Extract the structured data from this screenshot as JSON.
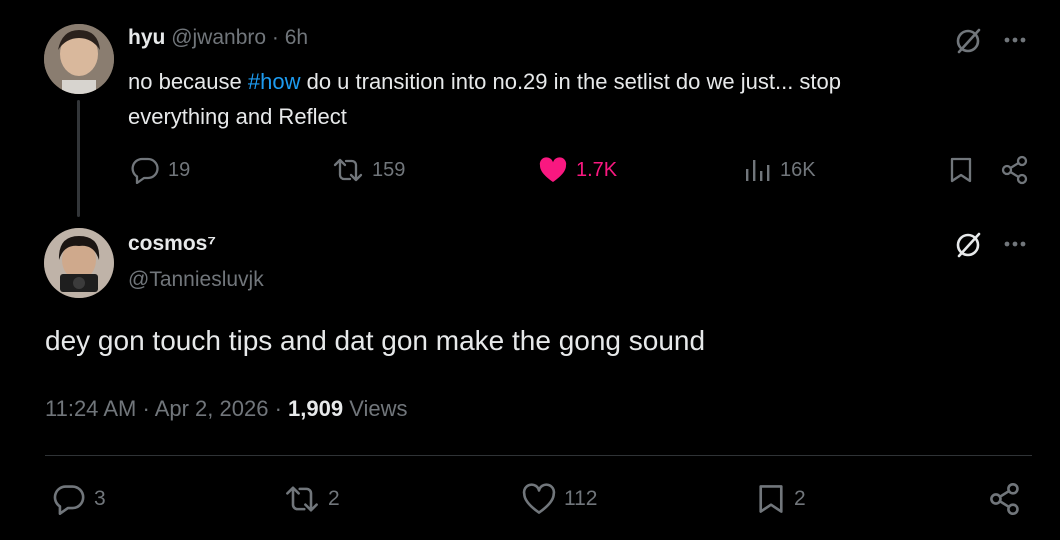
{
  "colors": {
    "background": "#000000",
    "text": "#e7e9ea",
    "muted": "#71767b",
    "accent": "#1d9bf0",
    "like": "#f91880",
    "divider": "#2f3336"
  },
  "parent_post": {
    "display_name": "hyu",
    "handle": "@jwanbro",
    "separator": "·",
    "time": "6h",
    "text_before": "no because ",
    "hashtag": "#how",
    "text_line1_after": " do u transition into no.29 in the setlist do we just... stop",
    "text_line2": "everything and Reflect",
    "stats": {
      "replies": "19",
      "reposts": "159",
      "likes": "1.7K",
      "views": "16K"
    },
    "icons": {
      "reply": "reply-icon",
      "repost": "repost-icon",
      "like": "heart-filled-icon",
      "views": "analytics-icon",
      "bookmark": "bookmark-icon",
      "share": "share-icon",
      "grok": "grok-icon",
      "more": "more-icon"
    }
  },
  "main_post": {
    "display_name": "cosmos⁷",
    "handle": "@Tanniesluvjk",
    "text": "dey gon touch tips and dat gon make the gong sound",
    "time": "11:24 AM",
    "sep1": "·",
    "date": "Apr 2, 2026",
    "sep2": "·",
    "views_count": "1,909",
    "views_label": " Views",
    "stats": {
      "replies": "3",
      "reposts": "2",
      "likes": "112",
      "bookmarks": "2"
    },
    "icons": {
      "reply": "reply-icon",
      "repost": "repost-icon",
      "like": "heart-outline-icon",
      "bookmark": "bookmark-icon",
      "share": "share-icon",
      "grok": "grok-icon",
      "more": "more-icon"
    }
  }
}
